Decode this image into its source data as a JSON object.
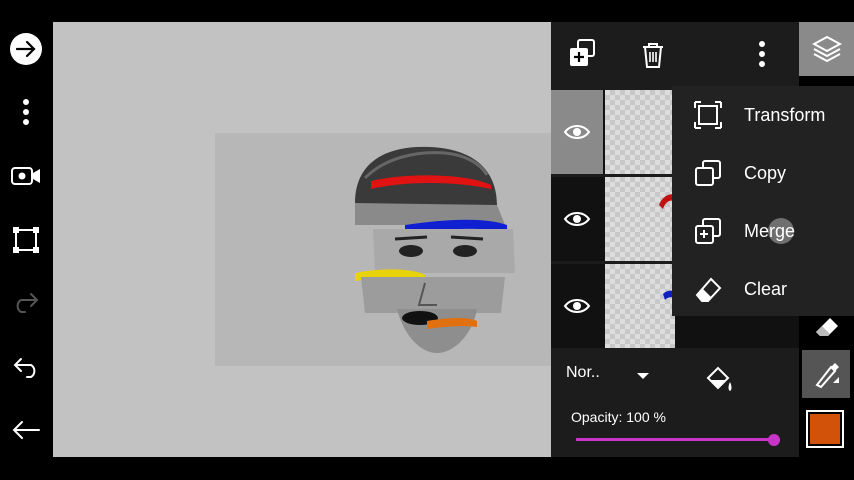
{
  "menu": {
    "items": [
      {
        "label": "Transform",
        "icon": "transform-icon"
      },
      {
        "label": "Copy",
        "icon": "copy-icon"
      },
      {
        "label": "Merge",
        "icon": "merge-icon"
      },
      {
        "label": "Clear",
        "icon": "clear-icon"
      }
    ]
  },
  "layers": {
    "blend_mode": "Nor..",
    "opacity_label": "Opacity:",
    "opacity_value": "100 %",
    "opacity_fraction": 1.0
  },
  "colors": {
    "accent": "#c833c8",
    "current_color": "#d2520a",
    "selected_tool_bg": "#8a8a8a"
  }
}
